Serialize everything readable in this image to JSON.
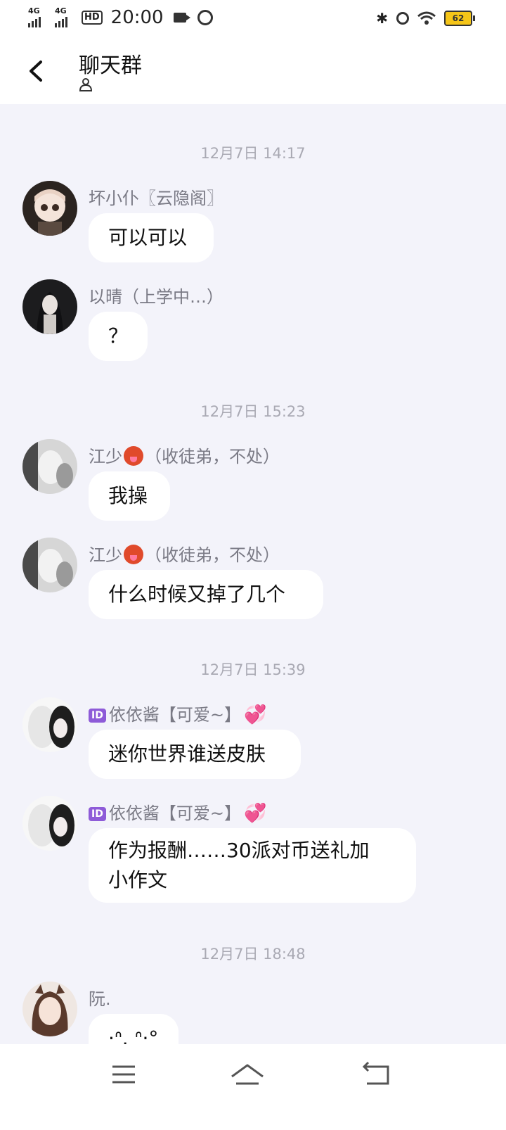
{
  "status_bar": {
    "signal1": "4G",
    "signal2": "4G",
    "hd": "HD",
    "time": "20:00",
    "battery": "62",
    "icons": [
      "signal-icon",
      "hd-icon",
      "video-icon",
      "app-icon",
      "bluetooth-icon",
      "alarm-icon",
      "wifi-icon",
      "battery-icon"
    ]
  },
  "header": {
    "title": "聊天群",
    "back_icon": "back-chevron-icon",
    "member_icon": "person-icon"
  },
  "timestamps": [
    "12月7日 14:17",
    "12月7日 15:23",
    "12月7日 15:39",
    "12月7日 18:48"
  ],
  "messages": [
    {
      "sender": "坏小仆〖云隐阁〗",
      "text": "可以可以"
    },
    {
      "sender": "以晴（上学中…）",
      "text": "？"
    },
    {
      "sender_pre": "江少",
      "sender_post": "（收徒弟，不处）",
      "text": "我操"
    },
    {
      "sender_pre": "江少",
      "sender_post": "（收徒弟，不处）",
      "text": "什么时候又掉了几个"
    },
    {
      "badge": "ID",
      "sender": "依依酱【可爱~】",
      "text": "迷你世界谁送皮肤"
    },
    {
      "badge": "ID",
      "sender": "依依酱【可爱~】",
      "text_line1": "作为报酬……30派对币送礼加",
      "text_line2": "小作文"
    },
    {
      "sender": "阮.",
      "text": "·ᐢ. ᐢ·°"
    }
  ],
  "nav": {
    "icons": [
      "menu-icon",
      "home-icon",
      "back-icon"
    ]
  }
}
